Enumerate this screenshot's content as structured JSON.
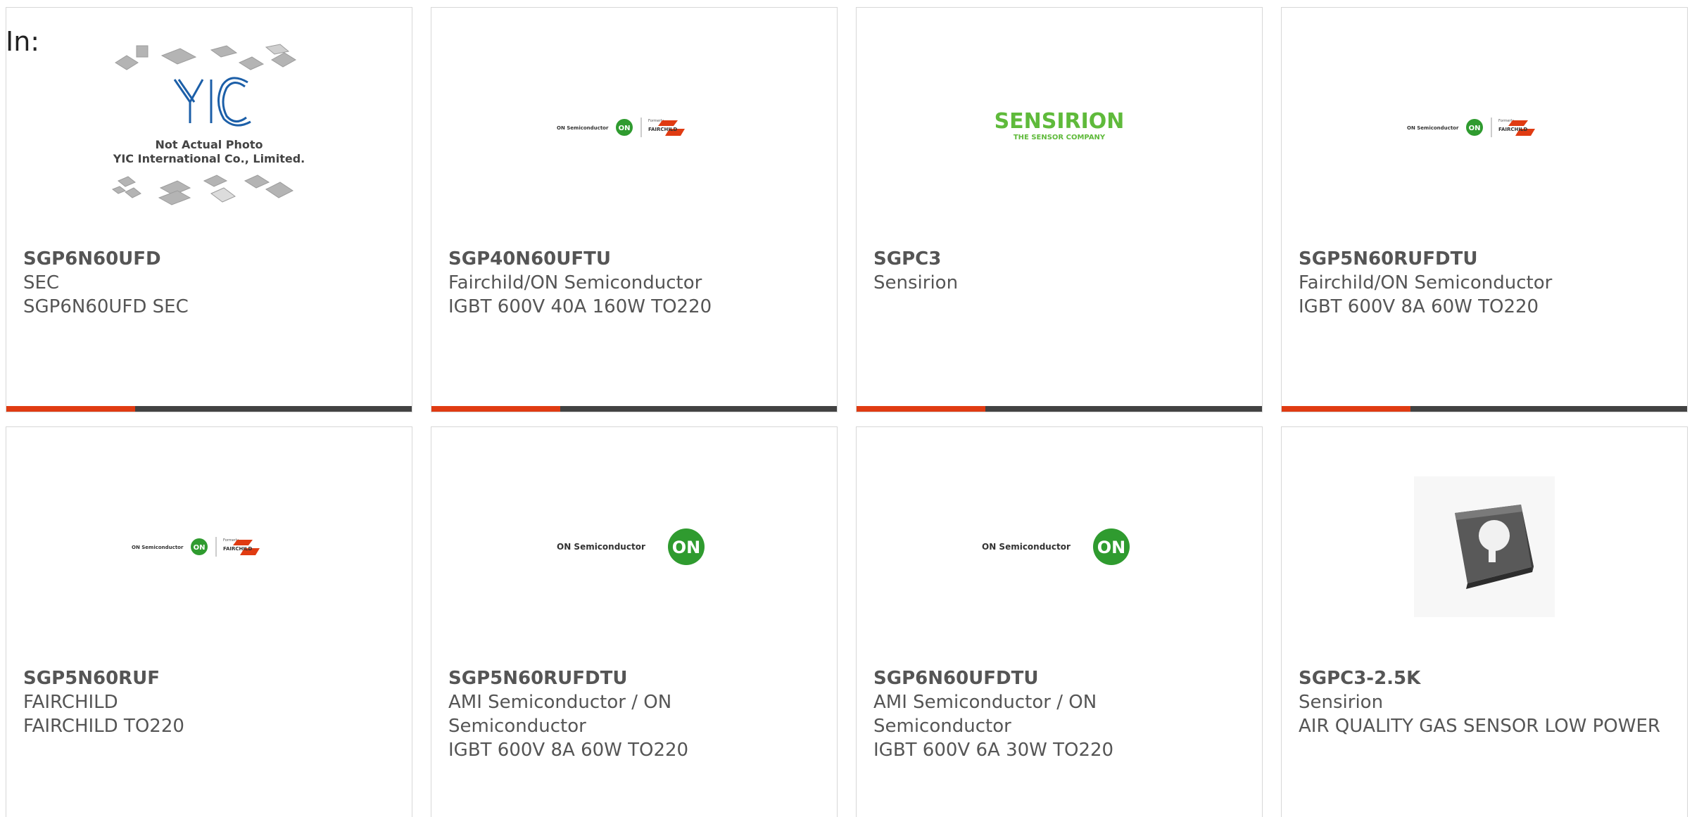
{
  "prefix": "In:",
  "placeholder": {
    "line1": "Not Actual Photo",
    "line2": "YIC International Co., Limited.",
    "logo": "YIC"
  },
  "sensirion": {
    "name": "SENSIRION",
    "tagline": "THE SENSOR COMPANY"
  },
  "on_logo": {
    "text": "ON Semiconductor",
    "mark": "ON",
    "formerly": "Formerly",
    "fairchild": "FAIRCHILD"
  },
  "colors": {
    "accent": "#e03b12",
    "bar_dark": "#424242",
    "on_green": "#2f9b2f",
    "sensirion_green": "#5fba3b",
    "yic_blue": "#1c5fa8"
  },
  "products": [
    {
      "part": "SGP6N60UFD",
      "manufacturer": "SEC",
      "description": "SGP6N60UFD SEC",
      "image": "placeholder-photo",
      "accent": true
    },
    {
      "part": "SGP40N60UFTU",
      "manufacturer": "Fairchild/ON Semiconductor",
      "description": "IGBT 600V 40A 160W TO220",
      "image": "on-fairchild-logo",
      "accent": true
    },
    {
      "part": "SGPC3",
      "manufacturer": "Sensirion",
      "description": "",
      "image": "sensirion-logo",
      "accent": true
    },
    {
      "part": "SGP5N60RUFDTU",
      "manufacturer": "Fairchild/ON Semiconductor",
      "description": "IGBT 600V 8A 60W TO220",
      "image": "on-fairchild-logo",
      "accent": true
    },
    {
      "part": "SGP5N60RUF",
      "manufacturer": "FAIRCHILD",
      "description": "FAIRCHILD TO220",
      "image": "on-fairchild-logo",
      "accent": false
    },
    {
      "part": "SGP5N60RUFDTU",
      "manufacturer": "AMI Semiconductor / ON Semiconductor",
      "description": "IGBT 600V 8A 60W TO220",
      "image": "on-semi-logo",
      "accent": false
    },
    {
      "part": "SGP6N60UFDTU",
      "manufacturer": "AMI Semiconductor / ON Semiconductor",
      "description": "IGBT 600V 6A 30W TO220",
      "image": "on-semi-logo",
      "accent": false
    },
    {
      "part": "SGPC3-2.5K",
      "manufacturer": "Sensirion",
      "description": "AIR QUALITY GAS SENSOR LOW POWER",
      "image": "sensor-chip-photo",
      "accent": false
    }
  ]
}
